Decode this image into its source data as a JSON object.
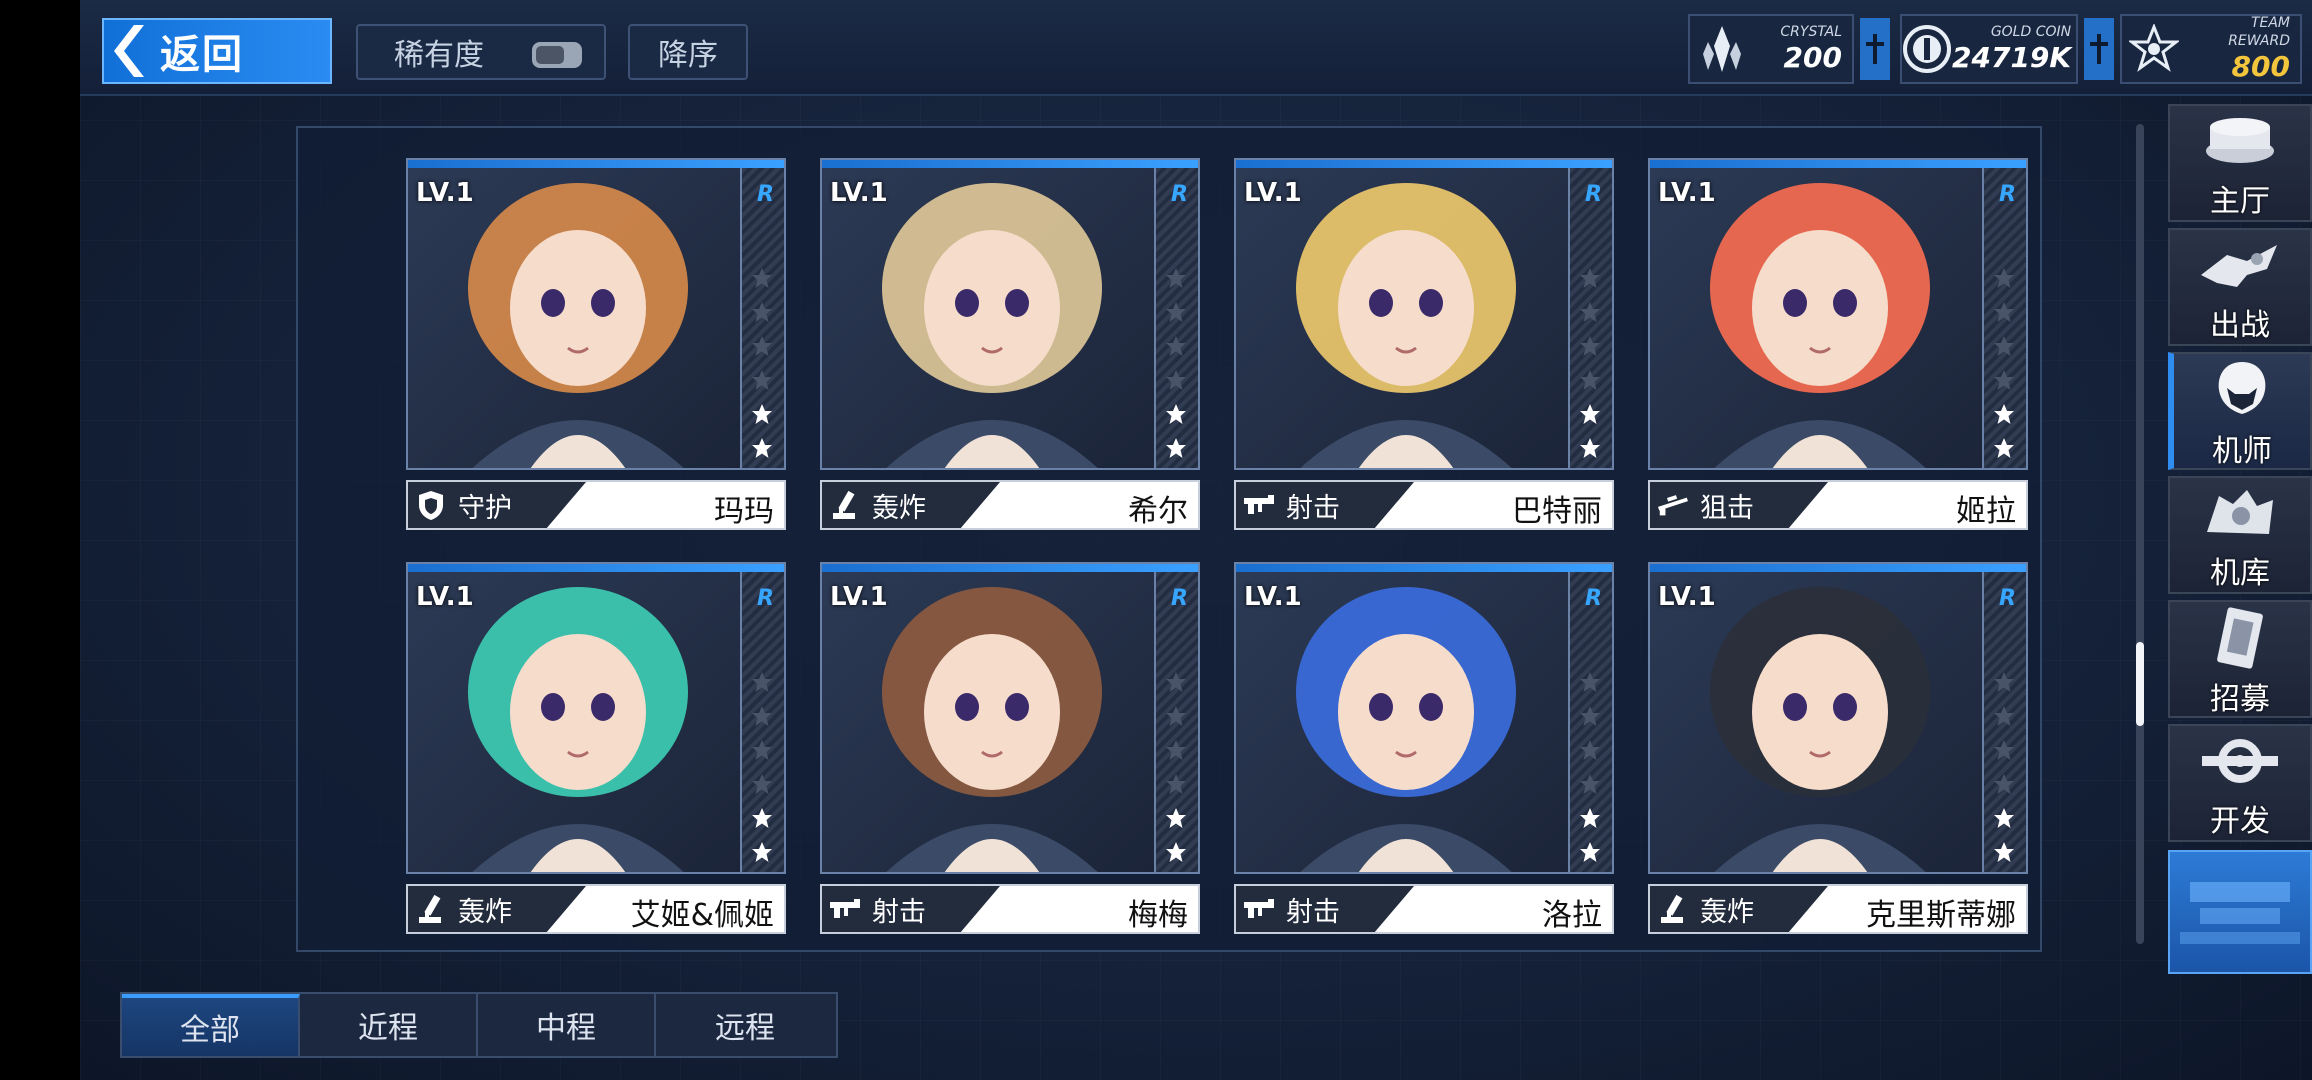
{
  "header": {
    "back_label": "返回",
    "sort_label": "稀有度",
    "order_label": "降序"
  },
  "resources": [
    {
      "title": "CRYSTAL",
      "value": "200",
      "icon": "crystal-icon",
      "color": "#ffffff"
    },
    {
      "title": "GOLD COIN",
      "value": "24719K",
      "icon": "gold-coin-icon",
      "color": "#ffffff"
    },
    {
      "title": "TEAM REWARD",
      "value": "800",
      "icon": "team-reward-icon",
      "color": "#f2c53d"
    }
  ],
  "pilots": [
    {
      "level": "LV.1",
      "rarity": "R",
      "role": "守护",
      "role_icon": "shield-icon",
      "name": "玛玛",
      "hair": "#d0864a"
    },
    {
      "level": "LV.1",
      "rarity": "R",
      "role": "轰炸",
      "role_icon": "mortar-icon",
      "name": "希尔",
      "hair": "#d8c296"
    },
    {
      "level": "LV.1",
      "rarity": "R",
      "role": "射击",
      "role_icon": "rifle-icon",
      "name": "巴特丽",
      "hair": "#e6c36a"
    },
    {
      "level": "LV.1",
      "rarity": "R",
      "role": "狙击",
      "role_icon": "sniper-icon",
      "name": "姬拉",
      "hair": "#f06a50"
    },
    {
      "level": "LV.1",
      "rarity": "R",
      "role": "轰炸",
      "role_icon": "mortar-icon",
      "name": "艾姬&佩姬",
      "hair": "#3cc7b0"
    },
    {
      "level": "LV.1",
      "rarity": "R",
      "role": "射击",
      "role_icon": "rifle-icon",
      "name": "梅梅",
      "hair": "#8a5a40"
    },
    {
      "level": "LV.1",
      "rarity": "R",
      "role": "射击",
      "role_icon": "rifle-icon",
      "name": "洛拉",
      "hair": "#3a6ad8"
    },
    {
      "level": "LV.1",
      "rarity": "R",
      "role": "轰炸",
      "role_icon": "mortar-icon",
      "name": "克里斯蒂娜",
      "hair": "#2a2f3a"
    }
  ],
  "star_rating": {
    "filled": 2,
    "total": 6
  },
  "nav": [
    {
      "label": "主厅",
      "icon": "hall-icon"
    },
    {
      "label": "出战",
      "icon": "battle-icon"
    },
    {
      "label": "机师",
      "icon": "pilot-icon",
      "active": true
    },
    {
      "label": "机库",
      "icon": "hangar-icon"
    },
    {
      "label": "招募",
      "icon": "recruit-icon"
    },
    {
      "label": "开发",
      "icon": "develop-icon"
    }
  ],
  "tabs": [
    {
      "label": "全部",
      "active": true
    },
    {
      "label": "近程"
    },
    {
      "label": "中程"
    },
    {
      "label": "远程"
    }
  ],
  "colors": {
    "accent": "#2a8cf2",
    "rarity": "#36a6ff",
    "reward": "#f2c53d"
  }
}
